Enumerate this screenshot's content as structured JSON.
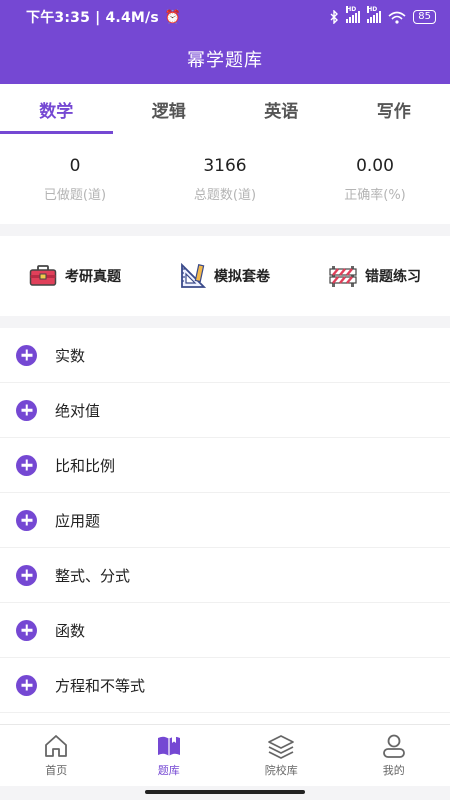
{
  "status_bar": {
    "time": "下午3:35 | 4.4M/s",
    "battery": "85",
    "hd_label": "HD"
  },
  "header": {
    "title": "幂学题库"
  },
  "tabs": [
    {
      "label": "数学",
      "active": true
    },
    {
      "label": "逻辑",
      "active": false
    },
    {
      "label": "英语",
      "active": false
    },
    {
      "label": "写作",
      "active": false
    }
  ],
  "stats": [
    {
      "value": "0",
      "label": "已做题(道)"
    },
    {
      "value": "3166",
      "label": "总题数(道)"
    },
    {
      "value": "0.00",
      "label": "正确率(%)"
    }
  ],
  "quick_actions": [
    {
      "label": "考研真题",
      "icon": "toolbox-icon"
    },
    {
      "label": "模拟套卷",
      "icon": "ruler-set-icon"
    },
    {
      "label": "错题练习",
      "icon": "barrier-icon"
    }
  ],
  "topics": [
    {
      "label": "实数"
    },
    {
      "label": "绝对值"
    },
    {
      "label": "比和比例"
    },
    {
      "label": "应用题"
    },
    {
      "label": "整式、分式"
    },
    {
      "label": "函数"
    },
    {
      "label": "方程和不等式"
    }
  ],
  "bottom_nav": [
    {
      "label": "首页",
      "icon": "home-icon",
      "active": false
    },
    {
      "label": "题库",
      "icon": "book-icon",
      "active": true
    },
    {
      "label": "院校库",
      "icon": "layers-icon",
      "active": false
    },
    {
      "label": "我的",
      "icon": "user-icon",
      "active": false
    }
  ],
  "colors": {
    "primary": "#7548d3",
    "background": "#f4f4f6",
    "muted_text": "#b4b4b4"
  }
}
